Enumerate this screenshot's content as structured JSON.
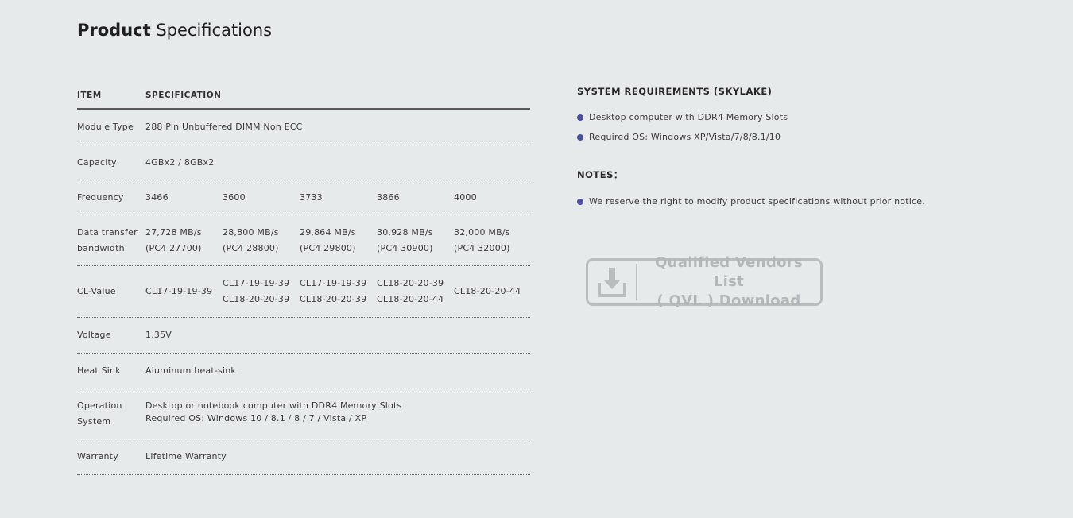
{
  "page": {
    "title_bold": "Product",
    "title_light": "Specifications"
  },
  "spec_table": {
    "headers": {
      "item": "ITEM",
      "spec": "SPECIFICATION"
    },
    "module_type": {
      "label": "Module Type",
      "value": "288 Pin Unbuffered DIMM Non ECC"
    },
    "capacity": {
      "label": "Capacity",
      "value": "4GBx2 / 8GBx2"
    },
    "frequency": {
      "label": "Frequency",
      "values": [
        "3466",
        "3600",
        "3733",
        "3866",
        "4000"
      ]
    },
    "bandwidth": {
      "label_line1": "Data transfer",
      "label_line2": "bandwidth",
      "values": [
        {
          "line1": "27,728 MB/s",
          "line2": "(PC4 27700)"
        },
        {
          "line1": "28,800 MB/s",
          "line2": "(PC4 28800)"
        },
        {
          "line1": "29,864 MB/s",
          "line2": "(PC4 29800)"
        },
        {
          "line1": "30,928 MB/s",
          "line2": "(PC4 30900)"
        },
        {
          "line1": "32,000 MB/s",
          "line2": "(PC4 32000)"
        }
      ]
    },
    "cl_value": {
      "label": "CL-Value",
      "values": [
        {
          "line1": "CL17-19-19-39",
          "line2": ""
        },
        {
          "line1": "CL17-19-19-39",
          "line2": "CL18-20-20-39"
        },
        {
          "line1": "CL17-19-19-39",
          "line2": "CL18-20-20-39"
        },
        {
          "line1": "CL18-20-20-39",
          "line2": "CL18-20-20-44"
        },
        {
          "line1": "CL18-20-20-44",
          "line2": ""
        }
      ]
    },
    "voltage": {
      "label": "Voltage",
      "value": "1.35V"
    },
    "heat_sink": {
      "label": "Heat Sink",
      "value": "Aluminum heat-sink"
    },
    "operation_system": {
      "label_line1": "Operation",
      "label_line2": "System",
      "value_line1": "Desktop or notebook computer with DDR4 Memory Slots",
      "value_line2": "Required OS: Windows 10 / 8.1 / 8 / 7 / Vista / XP"
    },
    "warranty": {
      "label": "Warranty",
      "value": "Lifetime Warranty"
    }
  },
  "system_requirements": {
    "heading": "SYSTEM REQUIREMENTS (SKYLAKE)",
    "items": [
      "Desktop computer with DDR4 Memory Slots",
      "Required OS: Windows XP/Vista/7/8/8.1/10"
    ]
  },
  "notes": {
    "heading": "NOTES：",
    "items": [
      "We reserve the right to modify product specifications without prior notice."
    ]
  },
  "qvl_button": {
    "line1": "Qualified Vendors List",
    "line2": "( QVL ) Download",
    "icon": "download-icon"
  },
  "colors": {
    "background": "#e6eaeb",
    "bullet": "#4a4f9c",
    "qvl_gray": "#b9bdbe"
  }
}
